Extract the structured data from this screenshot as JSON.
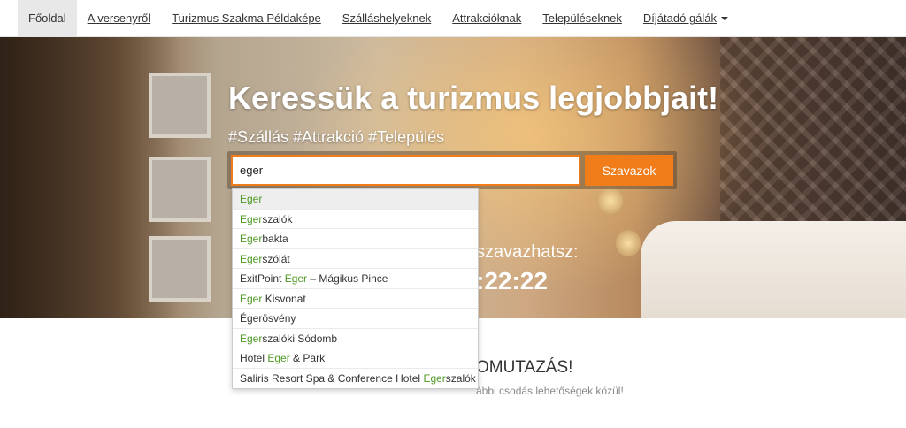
{
  "nav": {
    "items": [
      {
        "label": "Főoldal",
        "active": true
      },
      {
        "label": "A versenyről"
      },
      {
        "label": "Turizmus Szakma Példaképe"
      },
      {
        "label": "Szálláshelyeknek"
      },
      {
        "label": "Attrakcióknak"
      },
      {
        "label": "Településeknek"
      },
      {
        "label": "Díjátadó gálák",
        "has_caret": true
      }
    ]
  },
  "hero": {
    "title": "Keressük a turizmus legjobbjait!",
    "tags": "#Szállás #Attrakció #Település",
    "search_value": "eger",
    "search_button": "Szavazok",
    "vote_text": "szavazhatsz:",
    "vote_time": ":22:22"
  },
  "autocomplete": {
    "highlight_color": "#4e9a24",
    "items": [
      {
        "pre": "",
        "match": "Eger",
        "post": ""
      },
      {
        "pre": "",
        "match": "Eger",
        "post": "szalók"
      },
      {
        "pre": "",
        "match": "Eger",
        "post": "bakta"
      },
      {
        "pre": "",
        "match": "Eger",
        "post": "szólát"
      },
      {
        "pre": "ExitPoint ",
        "match": "Eger",
        "post": " – Mágikus Pince"
      },
      {
        "pre": "",
        "match": "Eger",
        "post": " Kisvonat"
      },
      {
        "pre": "Égerösvény",
        "match": "",
        "post": ""
      },
      {
        "pre": "",
        "match": "Eger",
        "post": "szalóki Sódomb"
      },
      {
        "pre": "Hotel ",
        "match": "Eger",
        "post": " & Park"
      },
      {
        "pre": "Saliris Resort Spa & Conference Hotel ",
        "match": "Eger",
        "post": "szalók"
      }
    ]
  },
  "section": {
    "title": "OMUTAZÁS!",
    "subtitle": "ábbi csodás lehetőségek közül!"
  },
  "colors": {
    "accent": "#f07c1a",
    "nav_active_bg": "#e8e8e8"
  }
}
